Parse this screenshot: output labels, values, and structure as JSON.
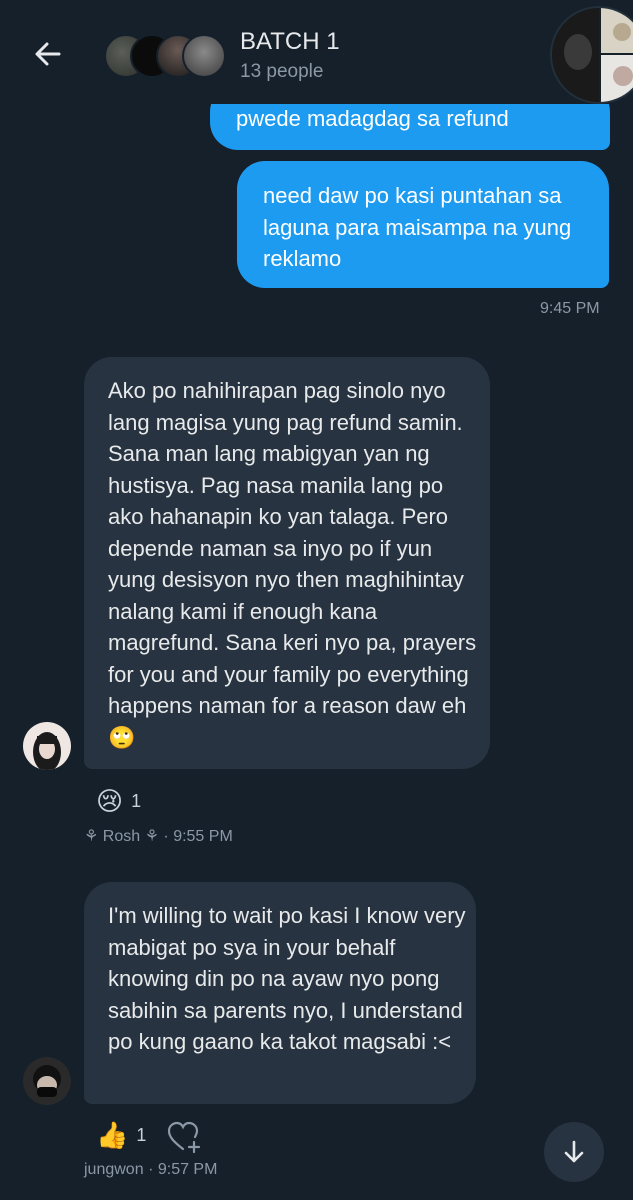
{
  "header": {
    "title": "BATCH 1",
    "subtitle": "13 people"
  },
  "messages": [
    {
      "text": "pwede madagdag sa refund"
    },
    {
      "text": "need daw po kasi puntahan sa laguna para maisampa na yung reklamo",
      "time": "9:45 PM"
    },
    {
      "text": "Ako po nahihirapan pag sinolo nyo lang magisa yung pag refund samin. Sana man lang mabigyan yan ng hustisya. Pag nasa manila lang po ako hahanapin ko yan talaga. Pero depende naman sa inyo po if yun yung desisyon nyo then maghihintay nalang kami if enough kana magrefund. Sana keri nyo pa, prayers for you and your family po everything happens naman for a reason daw eh",
      "emoji": "🙄",
      "reaction": {
        "emoji": "😢",
        "count": "1"
      },
      "sender": "Rosh",
      "time": "9:55 PM"
    },
    {
      "text": "I'm willing to wait po kasi I know very mabigat po sya in your behalf knowing din po na ayaw nyo pong sabihin sa parents nyo, I understand po kung gaano ka takot magsabi :<",
      "reaction": {
        "emoji": "👍",
        "count": "1"
      },
      "sender": "jungwon",
      "time": "9:57 PM"
    }
  ],
  "icons": {
    "back": "back-arrow-icon",
    "add_reaction": "heart-plus-icon",
    "scroll_down": "arrow-down-icon",
    "sender_decoration": "flower-icon"
  },
  "colors": {
    "background": "#15202b",
    "outgoing_bubble": "#1d9bf0",
    "incoming_bubble": "#273340",
    "muted_text": "#8b98a5"
  }
}
